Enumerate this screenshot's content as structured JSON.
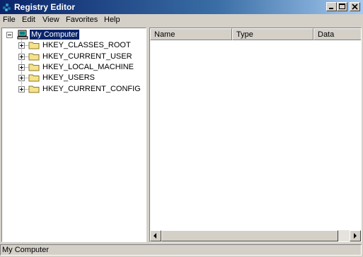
{
  "window": {
    "title": "Registry Editor"
  },
  "menu": [
    "File",
    "Edit",
    "View",
    "Favorites",
    "Help"
  ],
  "tree": {
    "root": "My Computer",
    "keys": [
      "HKEY_CLASSES_ROOT",
      "HKEY_CURRENT_USER",
      "HKEY_LOCAL_MACHINE",
      "HKEY_USERS",
      "HKEY_CURRENT_CONFIG"
    ]
  },
  "list": {
    "columns": [
      "Name",
      "Type",
      "Data"
    ]
  },
  "status": {
    "text": "My Computer"
  },
  "icons": {
    "app": "registry-editor-icon",
    "root": "my-computer-icon",
    "key": "folder-icon",
    "expand": "plus-expander-icon",
    "collapse": "minus-expander-icon"
  },
  "colors": {
    "titlebar": "#0a246a",
    "face": "#d4d0c8",
    "selection": "#0a246a",
    "folder": "#f5e28a"
  }
}
